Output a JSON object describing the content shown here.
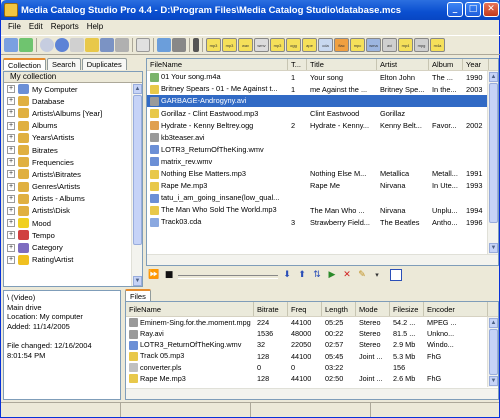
{
  "window": {
    "title": "Media Catalog Studio Pro 4.4 - D:\\Program Files\\Media Catalog Studio\\database.mcs"
  },
  "menu": [
    "File",
    "Edit",
    "Reports",
    "Help"
  ],
  "file_type_buttons": [
    "mp3",
    "mp3",
    "wav",
    "wmv",
    "mp3",
    "ogg",
    "ape",
    "cda",
    "flac",
    "mpc",
    "wma",
    "avi",
    "mp4",
    "mpg",
    "m4a"
  ],
  "left_tabs": [
    "Collection",
    "Search",
    "Duplicates"
  ],
  "tree": {
    "header": "My collection",
    "items": [
      {
        "label": "My Computer",
        "icon_color": "#6b8fd6"
      },
      {
        "label": "Database",
        "icon_color": "#e0b040"
      },
      {
        "label": "Artists\\Albums [Year]",
        "icon_color": "#e0b040"
      },
      {
        "label": "Albums",
        "icon_color": "#e0b040"
      },
      {
        "label": "Years\\Artists",
        "icon_color": "#e0b040"
      },
      {
        "label": "Bitrates",
        "icon_color": "#e0b040"
      },
      {
        "label": "Frequencies",
        "icon_color": "#e0b040"
      },
      {
        "label": "Artists\\Bitrates",
        "icon_color": "#e0b040"
      },
      {
        "label": "Genres\\Artists",
        "icon_color": "#e0b040"
      },
      {
        "label": "Artists - Albums",
        "icon_color": "#e0b040"
      },
      {
        "label": "Artists\\Disk",
        "icon_color": "#e0b040"
      },
      {
        "label": "Mood",
        "icon_color": "#f0d020"
      },
      {
        "label": "Tempo",
        "icon_color": "#d04040"
      },
      {
        "label": "Category",
        "icon_color": "#7e6cc0"
      },
      {
        "label": "Rating\\Artist",
        "icon_color": "#f0c020"
      }
    ]
  },
  "filelist": {
    "columns": [
      "FileName",
      "T...",
      "Title",
      "Artist",
      "Album",
      "Year"
    ],
    "rows": [
      {
        "file": "01 Your song.m4a",
        "track": "1",
        "title": "Your song",
        "artist": "Elton John",
        "album": "The ...",
        "year": "1990",
        "type": "m4a",
        "selected": false
      },
      {
        "file": "Britney Spears - 01 - Me Against t...",
        "track": "1",
        "title": "me Against the ...",
        "artist": "Britney Spe...",
        "album": "In the...",
        "year": "2003",
        "type": "mp3",
        "selected": false
      },
      {
        "file": "GARBAGE-Androgyny.avi",
        "track": "",
        "title": "",
        "artist": "",
        "album": "",
        "year": "",
        "type": "avi",
        "selected": true
      },
      {
        "file": "Gorillaz - Clint Eastwood.mp3",
        "track": "",
        "title": "Clint Eastwood",
        "artist": "Gorillaz",
        "album": "",
        "year": "",
        "type": "mp3",
        "selected": false
      },
      {
        "file": "Hydrate - Kenny Beltrey.ogg",
        "track": "2",
        "title": "Hydrate - Kenny...",
        "artist": "Kenny Belt...",
        "album": "Favor...",
        "year": "2002",
        "type": "ogg",
        "selected": false
      },
      {
        "file": "kb3teaser.avi",
        "track": "",
        "title": "",
        "artist": "",
        "album": "",
        "year": "",
        "type": "avi",
        "selected": false
      },
      {
        "file": "LOTR3_ReturnOfTheKing.wmv",
        "track": "",
        "title": "",
        "artist": "",
        "album": "",
        "year": "",
        "type": "wmv",
        "selected": false
      },
      {
        "file": "matrix_rev.wmv",
        "track": "",
        "title": "",
        "artist": "",
        "album": "",
        "year": "",
        "type": "wmv",
        "selected": false
      },
      {
        "file": "Nothing Else Matters.mp3",
        "track": "",
        "title": "Nothing Else M...",
        "artist": "Metallica",
        "album": "Metall...",
        "year": "1991",
        "type": "mp3",
        "selected": false
      },
      {
        "file": "Rape Me.mp3",
        "track": "",
        "title": "Rape Me",
        "artist": "Nirvana",
        "album": "In Ute...",
        "year": "1993",
        "type": "mp3",
        "selected": false
      },
      {
        "file": "tatu_i_am_going_insane(low_qual...",
        "track": "",
        "title": "",
        "artist": "",
        "album": "",
        "year": "",
        "type": "wmv",
        "selected": false
      },
      {
        "file": "The Man Who Sold The World.mp3",
        "track": "",
        "title": "The Man Who ...",
        "artist": "Nirvana",
        "album": "Unplu...",
        "year": "1994",
        "type": "mp3",
        "selected": false
      },
      {
        "file": "Track03.cda",
        "track": "3",
        "title": "Strawberry Field...",
        "artist": "The Beatles",
        "album": "Antho...",
        "year": "1996",
        "type": "cda",
        "selected": false
      }
    ]
  },
  "info": {
    "lines": [
      "\\ (Video)",
      "Main drive",
      "Location: My computer",
      "Added: 11/14/2005",
      "",
      "File changed: 12/16/2004",
      "8:01:54 PM"
    ]
  },
  "bottom_tabs": [
    "Files"
  ],
  "files_table": {
    "columns": [
      "FileName",
      "Bitrate",
      "Freq",
      "Length",
      "Mode",
      "Filesize",
      "Encoder"
    ],
    "rows": [
      {
        "file": "Eminem-Sing.for.the.moment.mpg",
        "bitrate": "224",
        "freq": "44100",
        "length": "05:25",
        "mode": "Stereo",
        "size": "54.2 ...",
        "encoder": "MPEG ...",
        "type": "mpg"
      },
      {
        "file": "Ray.avi",
        "bitrate": "1536",
        "freq": "48000",
        "length": "00:22",
        "mode": "Stereo",
        "size": "81.5 ...",
        "encoder": "Unkno...",
        "type": "avi"
      },
      {
        "file": "LOTR3_ReturnOfTheKing.wmv",
        "bitrate": "32",
        "freq": "22050",
        "length": "02:57",
        "mode": "Stereo",
        "size": "2.9 Mb",
        "encoder": "Windo...",
        "type": "wmv"
      },
      {
        "file": "Track 05.mp3",
        "bitrate": "128",
        "freq": "44100",
        "length": "05:45",
        "mode": "Joint ...",
        "size": "5.3 Mb",
        "encoder": "FhG",
        "type": "mp3"
      },
      {
        "file": "converter.pls",
        "bitrate": "0",
        "freq": "0",
        "length": "03:22",
        "mode": "",
        "size": "156",
        "encoder": "",
        "type": "pls"
      },
      {
        "file": "Rape Me.mp3",
        "bitrate": "128",
        "freq": "44100",
        "length": "02:50",
        "mode": "Joint ...",
        "size": "2.6 Mb",
        "encoder": "FhG",
        "type": "mp3"
      }
    ]
  }
}
